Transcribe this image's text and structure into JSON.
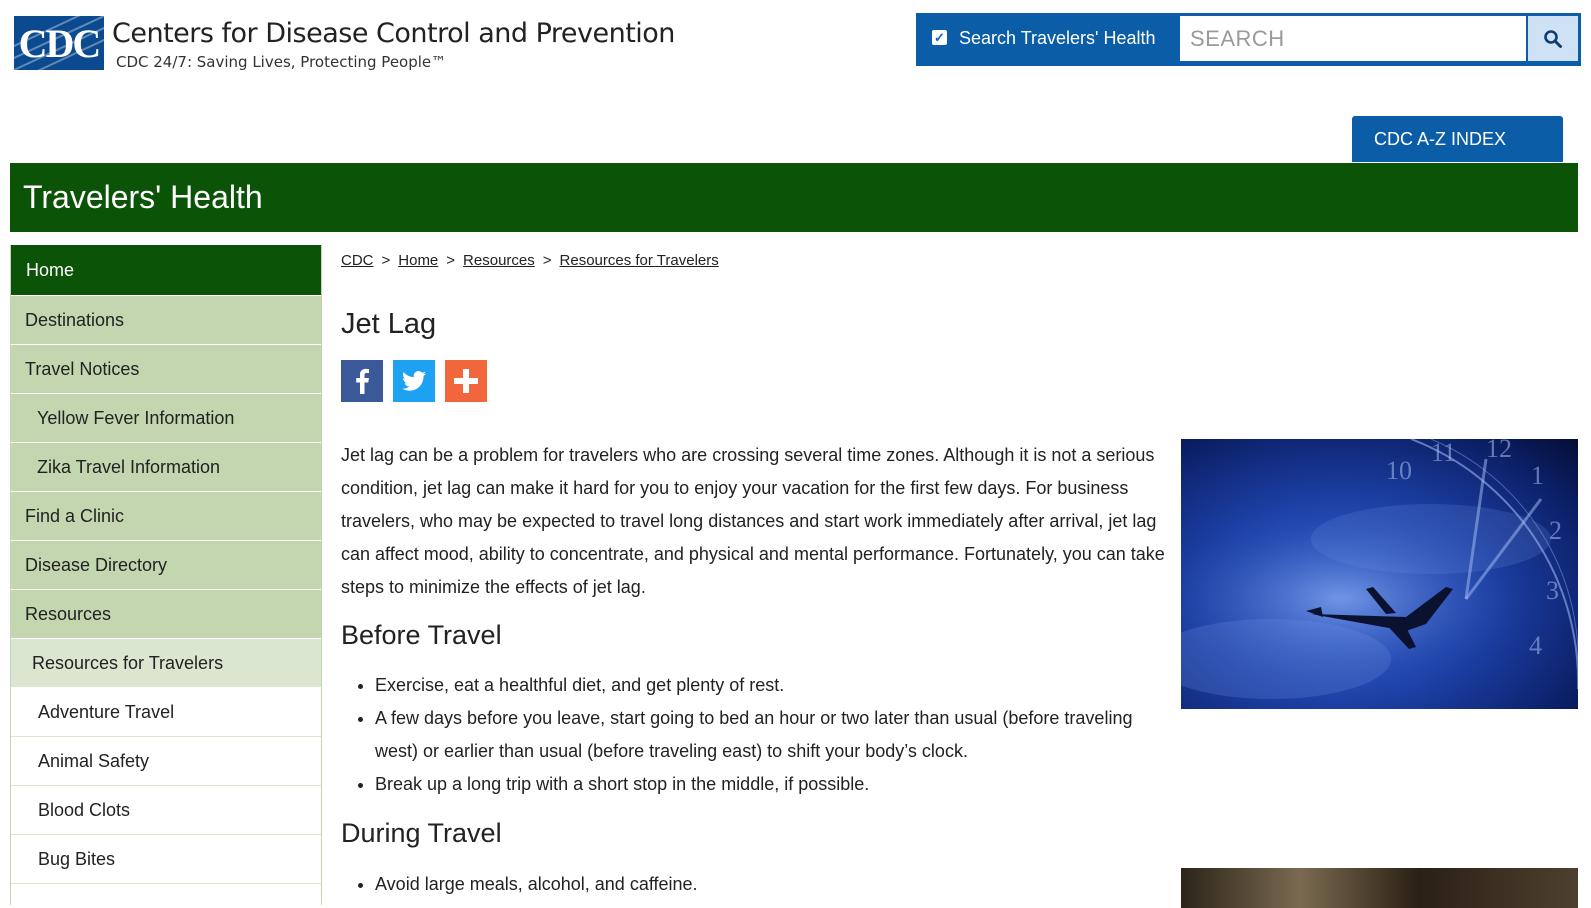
{
  "header": {
    "logo_text": "CDC",
    "agency_name": "Centers for Disease Control and Prevention",
    "tagline": "CDC 24/7: Saving Lives, Protecting People™",
    "search_checkbox_label": "Search Travelers' Health",
    "search_checked": true,
    "search_placeholder": "SEARCH",
    "search_value": "",
    "az_index_label": "CDC A-Z INDEX"
  },
  "banner": {
    "title": "Travelers' Health"
  },
  "sidebar": {
    "items": [
      {
        "label": "Home"
      },
      {
        "label": "Destinations"
      },
      {
        "label": "Travel Notices"
      },
      {
        "label": "Yellow Fever Information"
      },
      {
        "label": "Zika Travel Information"
      },
      {
        "label": "Find a Clinic"
      },
      {
        "label": "Disease Directory"
      },
      {
        "label": "Resources"
      },
      {
        "label": "Resources for Travelers"
      },
      {
        "label": "Adventure Travel"
      },
      {
        "label": "Animal Safety"
      },
      {
        "label": "Blood Clots"
      },
      {
        "label": "Bug Bites"
      }
    ]
  },
  "breadcrumb": {
    "items": [
      "CDC",
      "Home",
      "Resources",
      "Resources for Travelers"
    ],
    "separator": ">"
  },
  "main": {
    "title": "Jet Lag",
    "intro": "Jet lag can be a problem for travelers who are crossing several time zones. Although it is not a serious condition, jet lag can make it hard for you to enjoy your vacation for the first few days. For business travelers, who may be expected to travel long distances and start work immediately after arrival, jet lag can affect mood, ability to concentrate, and physical and mental performance. Fortunately, you can take steps to minimize the effects of jet lag.",
    "before_heading": "Before Travel",
    "before_items": [
      "Exercise, eat a healthful diet, and get plenty of rest.",
      "A few days before you leave, start going to bed an hour or two later than usual (before traveling west) or earlier than usual (before traveling east) to shift your body’s clock.",
      "Break up a long trip with a short stop in the middle, if possible."
    ],
    "during_heading": "During Travel",
    "during_items": [
      "Avoid large meals, alcohol, and caffeine."
    ]
  },
  "colors": {
    "cdc_blue": "#0a5da6",
    "banner_green": "#0b5307",
    "sidebar_green": "#c4d6b0",
    "facebook": "#3b5998",
    "twitter": "#1da1f2",
    "addthis": "#f2663d"
  },
  "icons": {
    "search": "magnifier-icon",
    "facebook": "facebook-icon",
    "twitter": "twitter-icon",
    "share": "plus-icon"
  }
}
